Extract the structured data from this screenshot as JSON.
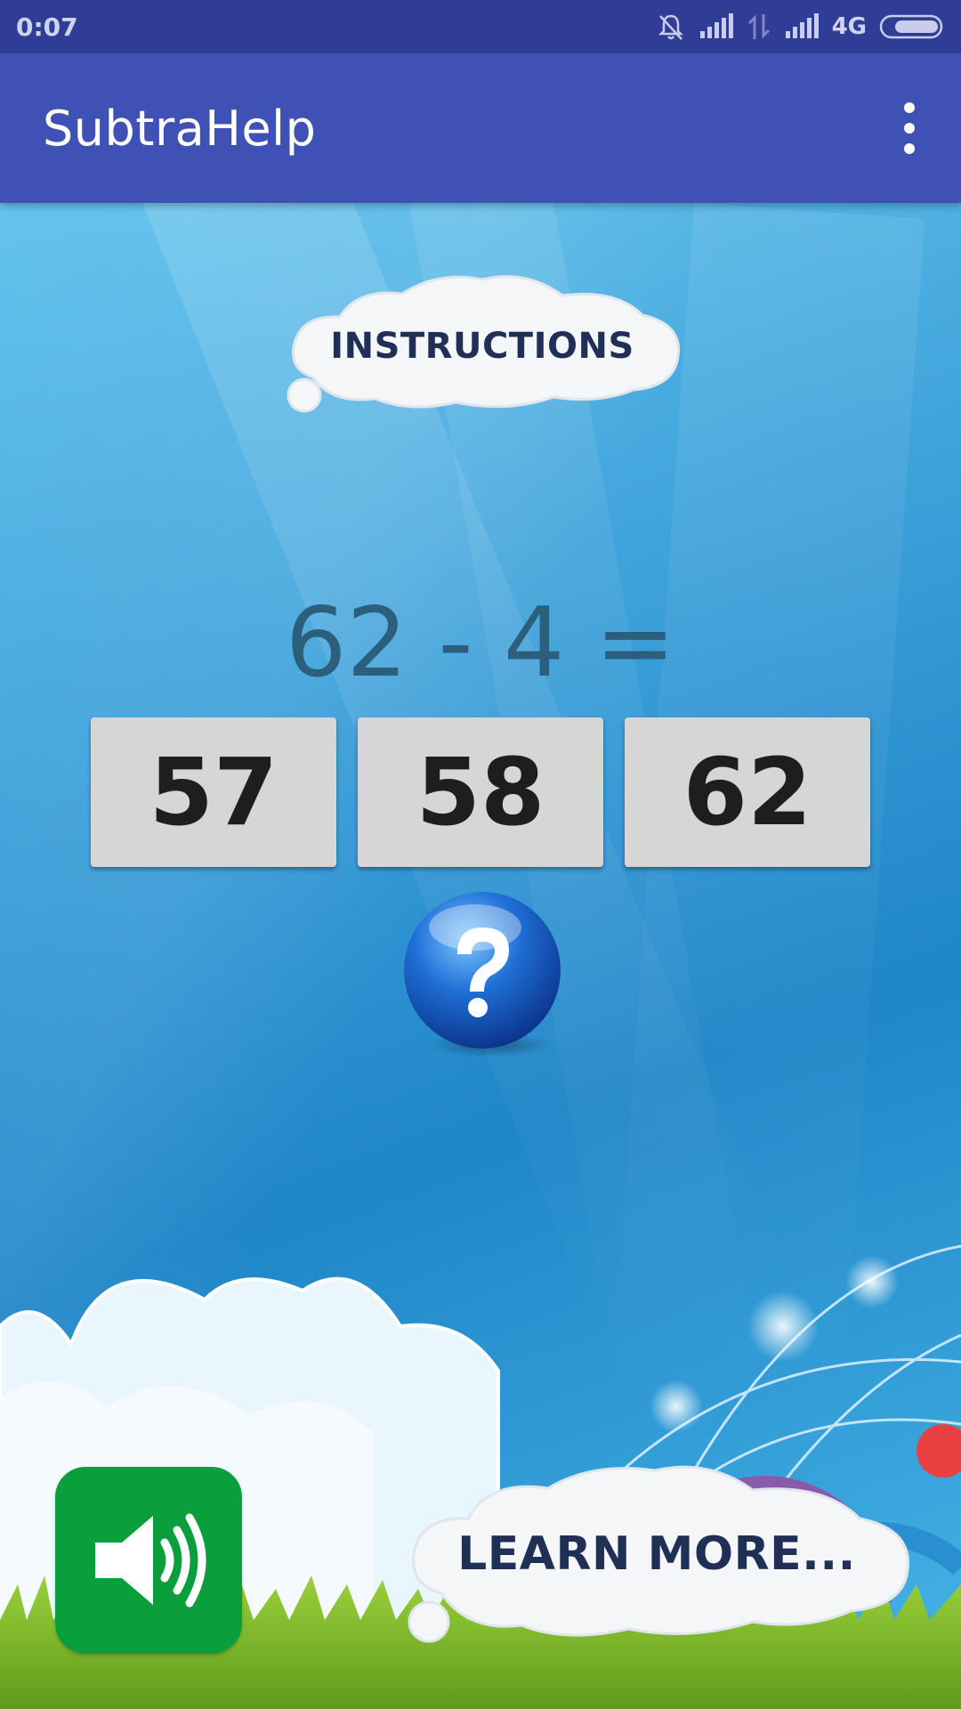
{
  "status_bar": {
    "time": "0:07",
    "network_label": "4G",
    "icons": [
      "bell-muted-icon",
      "signal-icon",
      "data-transfer-icon",
      "signal-icon",
      "battery-icon"
    ]
  },
  "app_bar": {
    "title": "SubtraHelp",
    "menu_icon": "overflow-menu-icon",
    "color": "#3f51b5"
  },
  "instructions_button": {
    "label": "INSTRUCTIONS"
  },
  "problem": {
    "equation": "62 - 4 ="
  },
  "answers": [
    "57",
    "58",
    "62"
  ],
  "help_button": {
    "icon": "question-mark-icon"
  },
  "sound_button": {
    "icon": "speaker-icon",
    "color": "#0a9e3c"
  },
  "learn_more_button": {
    "label": "LEARN MORE..."
  }
}
